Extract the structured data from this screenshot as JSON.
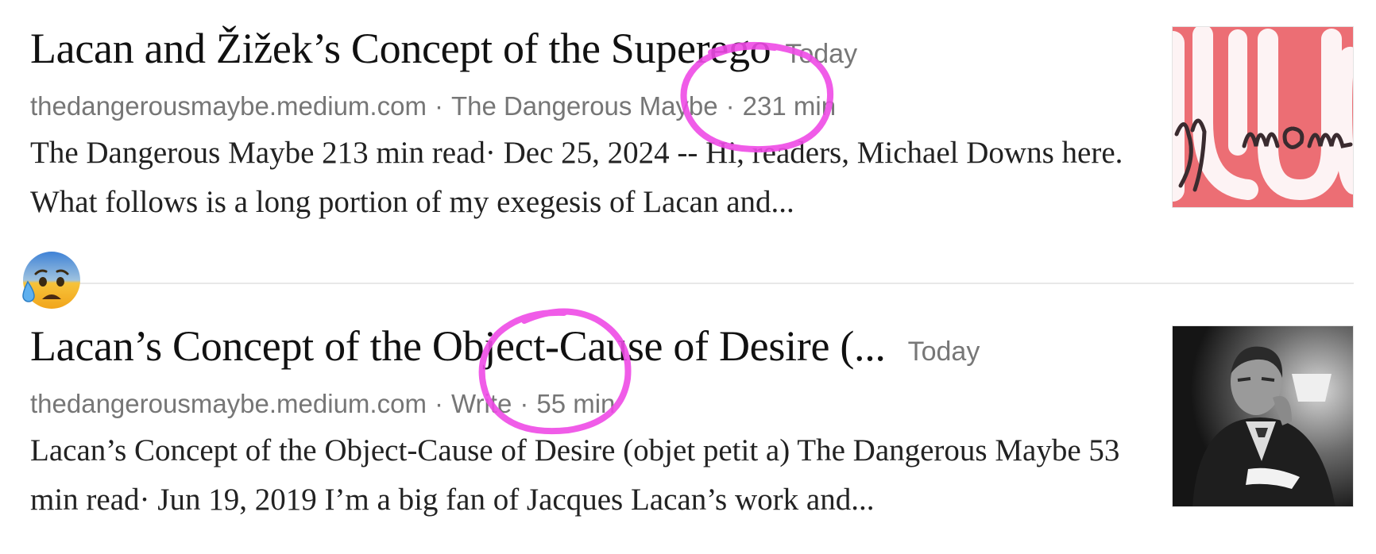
{
  "results": [
    {
      "title": "Lacan and Žižek’s Concept of the Superego",
      "age": "Today",
      "domain": "thedangerousmaybe.medium.com",
      "sep1": "·",
      "source": "The Dangerous Maybe",
      "sep2": "·",
      "read_time": "231 min",
      "snippet": "The Dangerous Maybe 213 min read· Dec 25, 2024 -- Hi, readers, Michael Downs here. What follows is a long portion of my exegesis of Lacan and...",
      "thumbnail": "pink-lettering-thumbnail"
    },
    {
      "title": "Lacan’s Concept of the Object-Cause of Desire (...",
      "age": "Today",
      "domain": "thedangerousmaybe.medium.com",
      "sep1": "·",
      "source": "Write",
      "sep2": "·",
      "read_time": "55 min",
      "snippet": "Lacan’s Concept of the Object-Cause of Desire (objet petit a) The Dangerous Maybe 53 min read· Jun 19, 2019 I’m a big fan of Jacques Lacan’s work and...",
      "thumbnail": "portrait-photo-thumbnail"
    }
  ],
  "overlay": {
    "emoji": "anxious-face-with-sweat",
    "annotation_color": "#ee4ae6"
  }
}
